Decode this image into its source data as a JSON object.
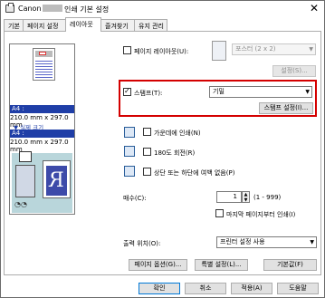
{
  "window": {
    "title_prefix": "Canon",
    "title_suffix": "인쇄 기본 설정",
    "close_glyph": "✕"
  },
  "tabs": [
    {
      "label": "기본"
    },
    {
      "label": "페이지 설정"
    },
    {
      "label": "레이아웃"
    },
    {
      "label": "즐겨찾기"
    },
    {
      "label": "유지 관리"
    }
  ],
  "preview": {
    "paper1_label": "A4 :",
    "paper1_size": "210.0 mm x 297.0 mm",
    "actual_size_label": "실제 크기",
    "paper2_label": "A4 :",
    "paper2_size": "210.0 mm x 297.0 mm",
    "output_letter": "R"
  },
  "page_layout": {
    "label": "페이지 레이아웃(U):",
    "checked": false,
    "selected": "포스터 (2 x 2)",
    "settings_button": "설정(S)..."
  },
  "stamp": {
    "label": "스탬프(T):",
    "checked": true,
    "selected": "기밀",
    "settings_button": "스탬프 설정(I)..."
  },
  "center": {
    "label": "가운데에 인쇄(N)",
    "checked": false
  },
  "rotate": {
    "label": "180도 회전(R)",
    "checked": false
  },
  "margins": {
    "label": "상단 또는 하단에 여백 없음(P)",
    "checked": false
  },
  "copies": {
    "label": "매수(C):",
    "value": "1",
    "range": "(1 - 999)",
    "last_page_first": {
      "label": "마지막 페이지부터 인쇄(I)",
      "checked": false
    }
  },
  "output": {
    "label": "출력 위치(O):",
    "selected": "프린터 설정 사용"
  },
  "bottom_buttons": {
    "page_options": "페이지 옵션(G)...",
    "special": "특별 설정(L)...",
    "defaults": "기본값(F)"
  },
  "dialog_buttons": {
    "ok": "확인",
    "cancel": "취소",
    "apply": "적용(A)",
    "help": "도움말"
  }
}
